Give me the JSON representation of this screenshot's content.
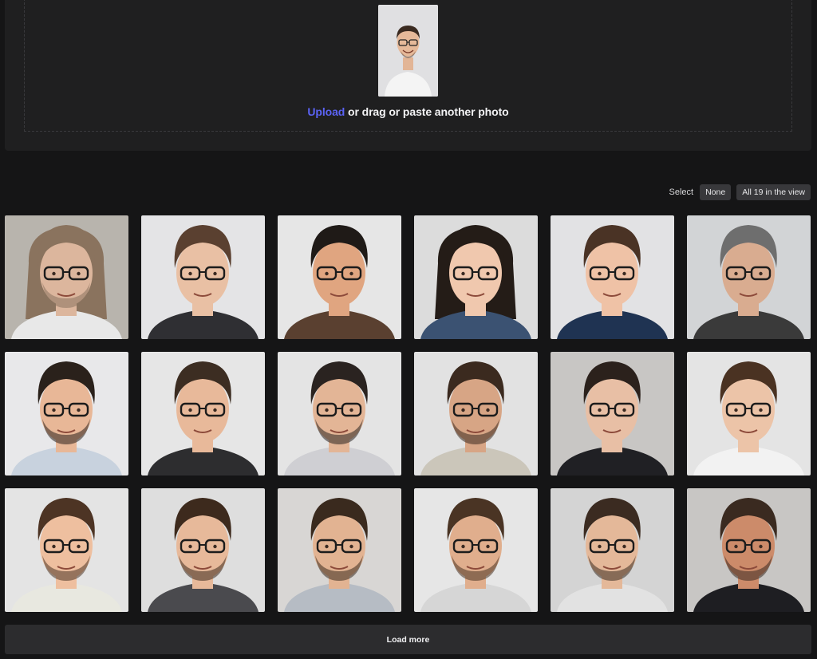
{
  "upload": {
    "link_label": "Upload",
    "rest_label": " or drag or paste another photo"
  },
  "select": {
    "label": "Select",
    "none_label": "None",
    "all_label": "All 19 in the view"
  },
  "results": [
    {
      "bg": "#b8b4ad",
      "skin": "#dcb69d",
      "hair": "#8a735e",
      "shirt": "#e8e8e8",
      "beard": true,
      "long": true
    },
    {
      "bg": "#e4e4e6",
      "skin": "#e9c0a4",
      "hair": "#5a4030",
      "shirt": "#2f2f33",
      "beard": false,
      "long": false
    },
    {
      "bg": "#e6e6e6",
      "skin": "#e0a580",
      "hair": "#1f1a17",
      "shirt": "#5a4030",
      "beard": false,
      "long": false
    },
    {
      "bg": "#dcdcdc",
      "skin": "#f0c8ae",
      "hair": "#241c17",
      "shirt": "#3b5272",
      "beard": false,
      "long": true
    },
    {
      "bg": "#e2e2e4",
      "skin": "#efc2a6",
      "hair": "#4a3325",
      "shirt": "#1f3352",
      "beard": false,
      "long": false
    },
    {
      "bg": "#d2d4d6",
      "skin": "#d9ac90",
      "hair": "#6e6e6e",
      "shirt": "#3a3a3a",
      "beard": false,
      "long": false
    },
    {
      "bg": "#e8e8ea",
      "skin": "#e8b797",
      "hair": "#2a211b",
      "shirt": "#c8d2de",
      "beard": true,
      "long": false
    },
    {
      "bg": "#e6e6e6",
      "skin": "#e8b99a",
      "hair": "#3c2d22",
      "shirt": "#2d2d2f",
      "beard": false,
      "long": false
    },
    {
      "bg": "#e4e4e4",
      "skin": "#e3b596",
      "hair": "#2a2320",
      "shirt": "#cfcfd3",
      "beard": true,
      "long": false
    },
    {
      "bg": "#e2e2e2",
      "skin": "#d7a585",
      "hair": "#3b2a1f",
      "shirt": "#cbc6ba",
      "beard": true,
      "long": false
    },
    {
      "bg": "#c8c6c4",
      "skin": "#e8bfa5",
      "hair": "#2b211c",
      "shirt": "#202024",
      "beard": false,
      "long": false
    },
    {
      "bg": "#e4e4e4",
      "skin": "#ecc4a8",
      "hair": "#4a3222",
      "shirt": "#f2f2f2",
      "beard": false,
      "long": false
    },
    {
      "bg": "#e4e4e4",
      "skin": "#eebf9f",
      "hair": "#4d3424",
      "shirt": "#e8e8e0",
      "beard": true,
      "long": false
    },
    {
      "bg": "#dedede",
      "skin": "#e7b99a",
      "hair": "#3d2a1d",
      "shirt": "#4a4a4e",
      "beard": true,
      "long": false
    },
    {
      "bg": "#d8d6d4",
      "skin": "#e2b392",
      "hair": "#3a2a1e",
      "shirt": "#b6bcc4",
      "beard": true,
      "long": false
    },
    {
      "bg": "#e6e6e6",
      "skin": "#e0ae8d",
      "hair": "#4a3424",
      "shirt": "#d6d6d6",
      "beard": true,
      "long": false
    },
    {
      "bg": "#d4d4d4",
      "skin": "#e4b899",
      "hair": "#3b2b21",
      "shirt": "#e2e2e2",
      "beard": true,
      "long": false
    },
    {
      "bg": "#c8c6c4",
      "skin": "#cc8b6a",
      "hair": "#3a2a20",
      "shirt": "#1e1e22",
      "beard": true,
      "long": false
    }
  ],
  "load_more_label": "Load more"
}
